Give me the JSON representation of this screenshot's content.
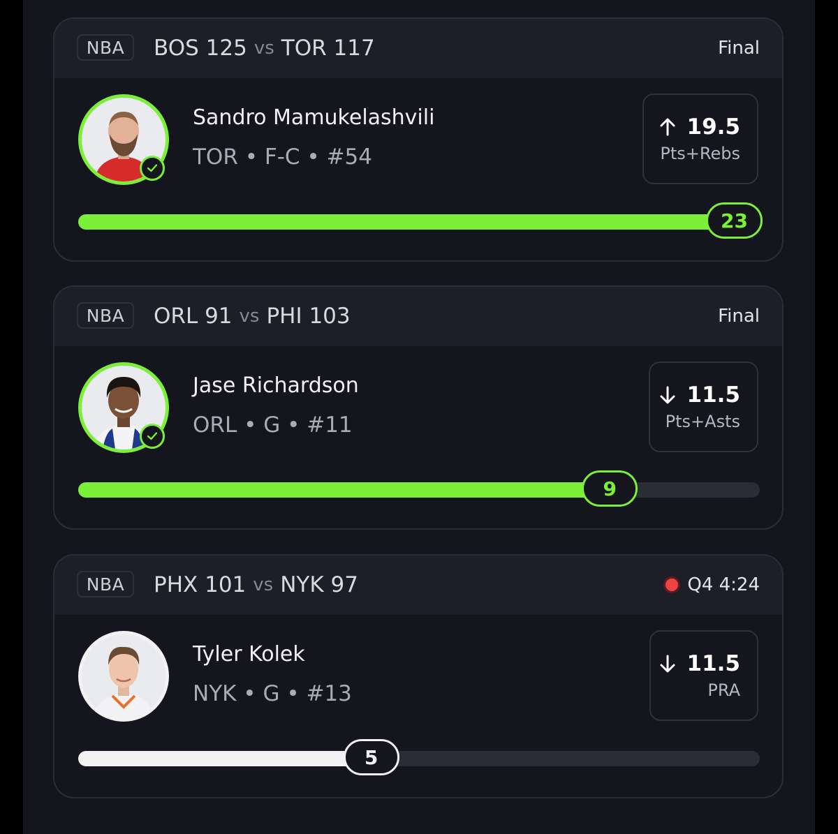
{
  "cards": [
    {
      "league": "NBA",
      "away_team": "BOS 125",
      "vs": "vs",
      "home_team": "TOR 117",
      "status": "Final",
      "live": false,
      "player": "Sandro Mamukelashvili",
      "meta": "TOR • F-C • #54",
      "direction": "up-arrow-icon",
      "line": "19.5",
      "stat": "Pts+Rebs",
      "progress_value": "23",
      "progress_fraction": 1.0,
      "result_color": "#7cf038",
      "hit": true
    },
    {
      "league": "NBA",
      "away_team": "ORL 91",
      "vs": "vs",
      "home_team": "PHI 103",
      "status": "Final",
      "live": false,
      "player": "Jase Richardson",
      "meta": "ORL • G • #11",
      "direction": "down-arrow-icon",
      "line": "11.5",
      "stat": "Pts+Asts",
      "progress_value": "9",
      "progress_fraction": 0.78,
      "result_color": "#7cf038",
      "hit": true
    },
    {
      "league": "NBA",
      "away_team": "PHX 101",
      "vs": "vs",
      "home_team": "NYK 97",
      "status": "Q4 4:24",
      "live": true,
      "player": "Tyler Kolek",
      "meta": "NYK • G • #13",
      "direction": "down-arrow-icon",
      "line": "11.5",
      "stat": "PRA",
      "progress_value": "5",
      "progress_fraction": 0.43,
      "result_color": "#f2f2f4",
      "hit": false
    }
  ]
}
